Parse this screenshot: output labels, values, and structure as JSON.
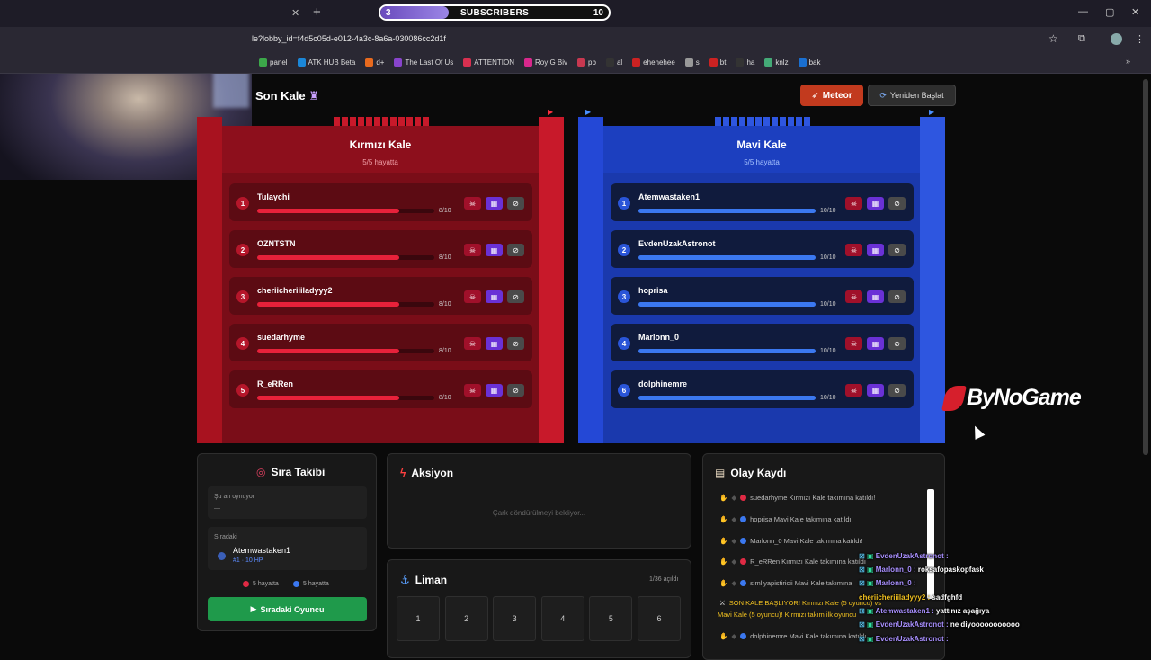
{
  "browser": {
    "subscribers": {
      "start": "3",
      "label": "SUBSCRIBERS",
      "goal": "10",
      "progress": 0.3
    },
    "url": "le?lobby_id=f4d5c05d-e012-4a3c-8a6a-030086cc2d1f",
    "bookmarks": [
      "panel",
      "ATK HUB Beta",
      "d+",
      "The Last Of Us",
      "ATTENTION",
      "Roy G Biv",
      "pb",
      "al",
      "ehehehee",
      "s",
      "bt",
      "ha",
      "knlz",
      "bak"
    ]
  },
  "game": {
    "title": "Son Kale",
    "meteor_label": "Meteor",
    "restart_label": "Yeniden Başlat"
  },
  "red": {
    "name": "Kırmızı Kale",
    "alive": "5/5 hayatta",
    "players": [
      {
        "num": "1",
        "name": "Tulaychi",
        "hp": "8/10",
        "fill": 0.8
      },
      {
        "num": "2",
        "name": "OZNTSTN",
        "hp": "8/10",
        "fill": 0.8
      },
      {
        "num": "3",
        "name": "cheriicheriiiladyyy2",
        "hp": "8/10",
        "fill": 0.8
      },
      {
        "num": "4",
        "name": "suedarhyme",
        "hp": "8/10",
        "fill": 0.8
      },
      {
        "num": "5",
        "name": "R_eRRen",
        "hp": "8/10",
        "fill": 0.8
      }
    ]
  },
  "blue": {
    "name": "Mavi Kale",
    "alive": "5/5 hayatta",
    "players": [
      {
        "num": "1",
        "name": "Atemwastaken1",
        "hp": "10/10",
        "fill": 1.0
      },
      {
        "num": "2",
        "name": "EvdenUzakAstronot",
        "hp": "10/10",
        "fill": 1.0
      },
      {
        "num": "3",
        "name": "hoprisa",
        "hp": "10/10",
        "fill": 1.0
      },
      {
        "num": "4",
        "name": "Marlonn_0",
        "hp": "10/10",
        "fill": 1.0
      },
      {
        "num": "6",
        "name": "dolphinemre",
        "hp": "10/10",
        "fill": 1.0
      }
    ]
  },
  "logo": "ByNoGame",
  "turn": {
    "title": "Sıra Takibi",
    "now_label": "Şu an oynuyor",
    "now_value": "—",
    "next_label": "Sıradaki",
    "next_name": "Atemwastaken1",
    "next_info": "#1 · 10 HP",
    "red_alive": "5 hayatta",
    "blue_alive": "5 hayatta",
    "next_button": "Sıradaki Oyuncu"
  },
  "action": {
    "title": "Aksiyon",
    "waiting": "Çark döndürülmeyi bekliyor..."
  },
  "harbor": {
    "title": "Liman",
    "opened": "1/36 açıldı",
    "cells": [
      "1",
      "2",
      "3",
      "4",
      "5",
      "6"
    ]
  },
  "log": {
    "title": "Olay Kaydı",
    "rows": [
      {
        "team": "red",
        "text": "suedarhyme Kırmızı Kale takımına katıldı!"
      },
      {
        "team": "blue",
        "text": "hoprisa Mavi Kale takımına katıldı!"
      },
      {
        "team": "blue",
        "text": "Marlonn_0 Mavi Kale takımına katıldı!"
      },
      {
        "team": "red",
        "text": "R_eRRen Kırmızı Kale takımına katıldı"
      },
      {
        "team": "blue",
        "text": "simliyapistiricii Mavi Kale takımına"
      },
      {
        "team": "start",
        "text": "SON KALE BAŞLIYOR! Kırmızı Kale (5 oyuncu) vs"
      },
      {
        "team": "start2",
        "text": "Mavi Kale (5 oyuncu)! Kırmızı takım ilk oyuncu"
      },
      {
        "team": "blue",
        "text": "dolphinemre Mavi Kale takımına katıldı"
      }
    ]
  },
  "chat": [
    {
      "user": "EvdenUzakAstronot :",
      "msg": ""
    },
    {
      "user": "Marlonn_0 :",
      "msg": "roksafopaskopfask"
    },
    {
      "user": "Marlonn_0 :",
      "msg": ""
    },
    {
      "user": "cheriicheriiiladyyy2 :",
      "msg": "sadfghfd"
    },
    {
      "user": "Atemwastaken1 :",
      "msg": "yattınız aşağıya"
    },
    {
      "user": "EvdenUzakAstronot :",
      "msg": "ne diyooooooooooo"
    },
    {
      "user": "EvdenUzakAstronot :",
      "msg": ""
    }
  ]
}
